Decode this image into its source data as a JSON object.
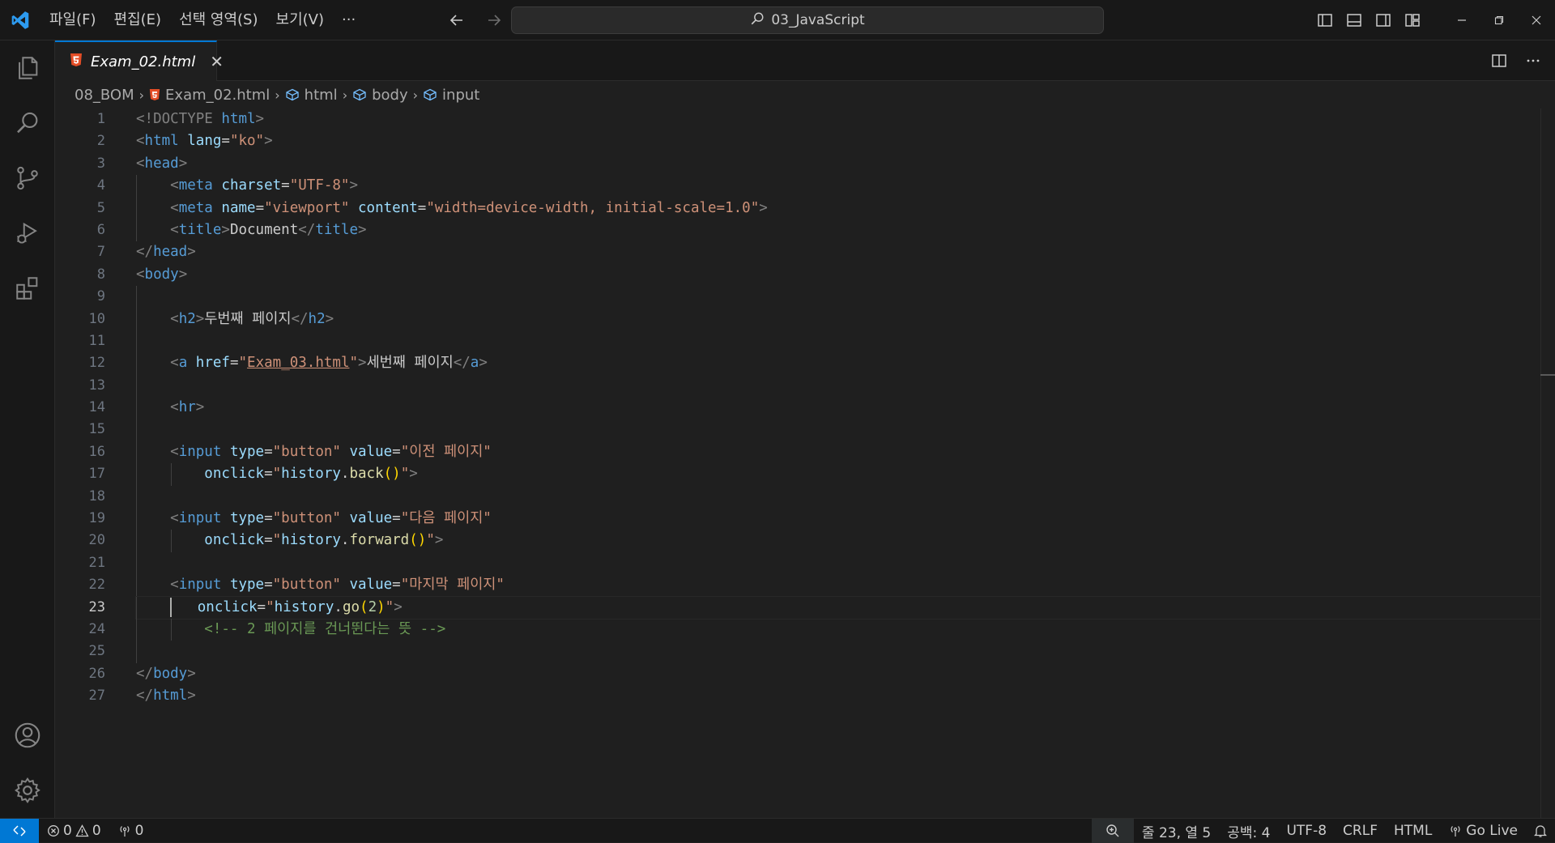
{
  "menu": {
    "file": "파일(F)",
    "edit": "편집(E)",
    "selection": "선택 영역(S)",
    "view": "보기(V)",
    "more": "···"
  },
  "command_center": {
    "text": "03_JavaScript"
  },
  "tab": {
    "label": "Exam_02.html",
    "close": "✕"
  },
  "breadcrumb": {
    "folder": "08_BOM",
    "file": "Exam_02.html",
    "html": "html",
    "body": "body",
    "input": "input"
  },
  "code": {
    "line_numbers": [
      "1",
      "2",
      "3",
      "4",
      "5",
      "6",
      "7",
      "8",
      "9",
      "10",
      "11",
      "12",
      "13",
      "14",
      "15",
      "16",
      "17",
      "18",
      "19",
      "20",
      "21",
      "22",
      "23",
      "24",
      "25",
      "26",
      "27"
    ],
    "active_line": "23",
    "doctype": "<!DOCTYPE",
    "kw_html": "html",
    "lang_attr": "lang",
    "lang_val": "\"ko\"",
    "charset_attr": "charset",
    "charset_val": "\"UTF-8\"",
    "name_attr": "name",
    "name_val": "\"viewport\"",
    "content_attr": "content",
    "content_val": "\"width=device-width, initial-scale=1.0\"",
    "title_text": "Document",
    "h2_text": "두번째 페이지",
    "href_attr": "href",
    "href_val": "Exam_03.html",
    "a_text": "세번째 페이지",
    "type_attr": "type",
    "type_val": "\"button\"",
    "value_attr": "value",
    "value_prev": "\"이전 페이지\"",
    "value_next": "\"다음 페이지\"",
    "value_last": "\"마지막 페이지\"",
    "onclick_attr": "onclick",
    "history": "history",
    "back": "back",
    "forward": "forward",
    "go": "go",
    "go_arg": "2",
    "comment": "<!-- 2 페이지를 건너뛴다는 뜻 -->"
  },
  "status": {
    "errors": "0",
    "warnings": "0",
    "ports": "0",
    "position": "줄 23, 열 5",
    "spaces": "공백: 4",
    "encoding": "UTF-8",
    "eol": "CRLF",
    "language": "HTML",
    "golive": "Go Live"
  },
  "colors": {
    "accent": "#0078d4",
    "html_icon": "#e44d26",
    "background": "#1f1f1f"
  }
}
